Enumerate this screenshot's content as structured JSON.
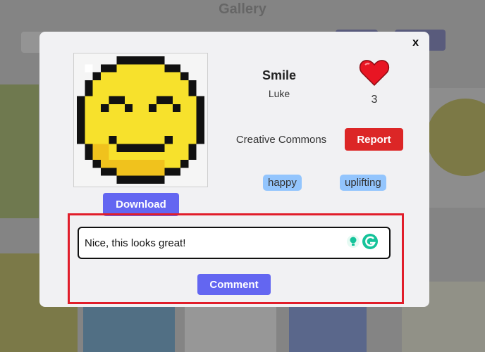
{
  "page": {
    "gallery_title": "Gallery"
  },
  "modal": {
    "close_label": "x",
    "artwork": {
      "title": "Smile",
      "author": "Luke",
      "likes": "3",
      "license": "Creative Commons",
      "tags": [
        "happy",
        "uplifting"
      ],
      "image_icon": "pixel-smiley-face"
    },
    "download_label": "Download",
    "report_label": "Report",
    "comment": {
      "value": "Nice, this looks great!",
      "submit_label": "Comment"
    },
    "colors": {
      "accent": "#6366f1",
      "danger": "#dc2626",
      "tag": "#93c5fd",
      "highlight": "#e11d2a"
    }
  }
}
